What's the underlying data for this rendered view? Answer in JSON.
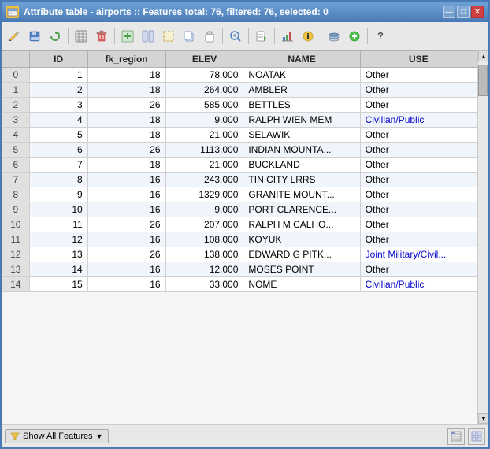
{
  "window": {
    "title": "Attribute table - airports :: Features total: 76, filtered: 76, selected: 0",
    "icon": "🗃"
  },
  "title_controls": {
    "minimize": "—",
    "maximize": "□",
    "close": "✕"
  },
  "toolbar": {
    "buttons": [
      {
        "name": "edit-icon",
        "symbol": "✏",
        "label": "Edit"
      },
      {
        "name": "save-icon",
        "symbol": "💾",
        "label": "Save"
      },
      {
        "name": "refresh-icon",
        "symbol": "↻",
        "label": "Refresh"
      },
      {
        "name": "table-icon",
        "symbol": "⊞",
        "label": "Table"
      },
      {
        "name": "delete-icon",
        "symbol": "🗑",
        "label": "Delete"
      },
      {
        "name": "sep1",
        "symbol": "",
        "label": ""
      },
      {
        "name": "new-col-icon",
        "symbol": "⊞",
        "label": "New Column"
      },
      {
        "name": "col-icon",
        "symbol": "▦",
        "label": "Column"
      },
      {
        "name": "select-icon",
        "symbol": "◻",
        "label": "Select"
      },
      {
        "name": "copy-icon",
        "symbol": "⧉",
        "label": "Copy"
      },
      {
        "name": "paste-icon",
        "symbol": "📋",
        "label": "Paste"
      },
      {
        "name": "sep2",
        "symbol": "",
        "label": ""
      },
      {
        "name": "zoom-icon",
        "symbol": "🔍",
        "label": "Zoom"
      },
      {
        "name": "sep3",
        "symbol": "",
        "label": ""
      },
      {
        "name": "export-icon",
        "symbol": "📄",
        "label": "Export"
      },
      {
        "name": "sep4",
        "symbol": "",
        "label": ""
      },
      {
        "name": "stats-icon",
        "symbol": "📊",
        "label": "Stats"
      },
      {
        "name": "action-icon",
        "symbol": "⚙",
        "label": "Action"
      },
      {
        "name": "sep5",
        "symbol": "",
        "label": ""
      },
      {
        "name": "layer-icon",
        "symbol": "🗂",
        "label": "Layer"
      },
      {
        "name": "add-icon",
        "symbol": "➕",
        "label": "Add"
      },
      {
        "name": "help-icon",
        "symbol": "?",
        "label": "Help"
      }
    ]
  },
  "table": {
    "columns": [
      "ID",
      "fk_region",
      "ELEV",
      "NAME",
      "USE"
    ],
    "rows": [
      {
        "row_num": "0",
        "id": "1",
        "fk_region": "18",
        "elev": "78.000",
        "name": "NOATAK",
        "use": "Other",
        "use_type": "other"
      },
      {
        "row_num": "1",
        "id": "2",
        "fk_region": "18",
        "elev": "264.000",
        "name": "AMBLER",
        "use": "Other",
        "use_type": "other"
      },
      {
        "row_num": "2",
        "id": "3",
        "fk_region": "26",
        "elev": "585.000",
        "name": "BETTLES",
        "use": "Other",
        "use_type": "other"
      },
      {
        "row_num": "3",
        "id": "4",
        "fk_region": "18",
        "elev": "9.000",
        "name": "RALPH WIEN MEM",
        "use": "Civilian/Public",
        "use_type": "civilian"
      },
      {
        "row_num": "4",
        "id": "5",
        "fk_region": "18",
        "elev": "21.000",
        "name": "SELAWIK",
        "use": "Other",
        "use_type": "other"
      },
      {
        "row_num": "5",
        "id": "6",
        "fk_region": "26",
        "elev": "1113.000",
        "name": "INDIAN MOUNTA...",
        "use": "Other",
        "use_type": "other"
      },
      {
        "row_num": "6",
        "id": "7",
        "fk_region": "18",
        "elev": "21.000",
        "name": "BUCKLAND",
        "use": "Other",
        "use_type": "other"
      },
      {
        "row_num": "7",
        "id": "8",
        "fk_region": "16",
        "elev": "243.000",
        "name": "TIN CITY LRRS",
        "use": "Other",
        "use_type": "other"
      },
      {
        "row_num": "8",
        "id": "9",
        "fk_region": "16",
        "elev": "1329.000",
        "name": "GRANITE MOUNT...",
        "use": "Other",
        "use_type": "other"
      },
      {
        "row_num": "9",
        "id": "10",
        "fk_region": "16",
        "elev": "9.000",
        "name": "PORT CLARENCE...",
        "use": "Other",
        "use_type": "other"
      },
      {
        "row_num": "10",
        "id": "11",
        "fk_region": "26",
        "elev": "207.000",
        "name": "RALPH M CALHO...",
        "use": "Other",
        "use_type": "other"
      },
      {
        "row_num": "11",
        "id": "12",
        "fk_region": "16",
        "elev": "108.000",
        "name": "KOYUK",
        "use": "Other",
        "use_type": "other"
      },
      {
        "row_num": "12",
        "id": "13",
        "fk_region": "26",
        "elev": "138.000",
        "name": "EDWARD G PITK...",
        "use": "Joint Military/Civil...",
        "use_type": "joint"
      },
      {
        "row_num": "13",
        "id": "14",
        "fk_region": "16",
        "elev": "12.000",
        "name": "MOSES POINT",
        "use": "Other",
        "use_type": "other"
      },
      {
        "row_num": "14",
        "id": "15",
        "fk_region": "16",
        "elev": "33.000",
        "name": "NOME",
        "use": "Civilian/Public",
        "use_type": "civilian"
      }
    ]
  },
  "status_bar": {
    "show_features_label": "Show All Features",
    "icon1": "≡",
    "icon2": "⊞"
  }
}
